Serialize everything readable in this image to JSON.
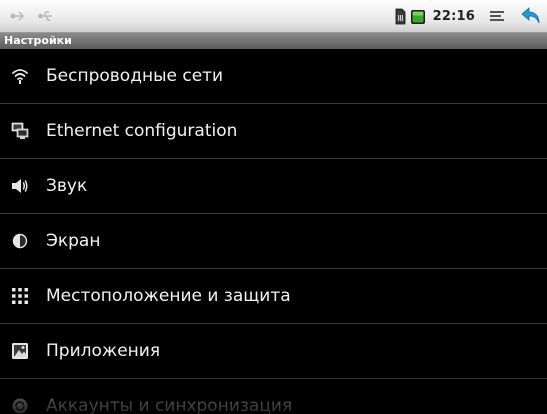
{
  "status_bar": {
    "time": "22:16",
    "icons": [
      "usb-debug-icon",
      "usb-icon",
      "sim-icon",
      "battery-icon",
      "menu-icon",
      "back-icon"
    ],
    "colors": {
      "battery": "#3da52a",
      "back": "#1e9ad6"
    }
  },
  "title_bar": {
    "title": "Настройки"
  },
  "settings": {
    "items": [
      {
        "label": "Беспроводные сети",
        "icon": "wifi-icon"
      },
      {
        "label": "Ethernet configuration",
        "icon": "ethernet-icon"
      },
      {
        "label": "Звук",
        "icon": "speaker-icon"
      },
      {
        "label": "Экран",
        "icon": "brightness-icon"
      },
      {
        "label": "Местоположение и защита",
        "icon": "location-security-icon"
      },
      {
        "label": "Приложения",
        "icon": "applications-icon"
      },
      {
        "label": "Аккаунты и синхронизация",
        "icon": "accounts-sync-icon"
      }
    ]
  }
}
